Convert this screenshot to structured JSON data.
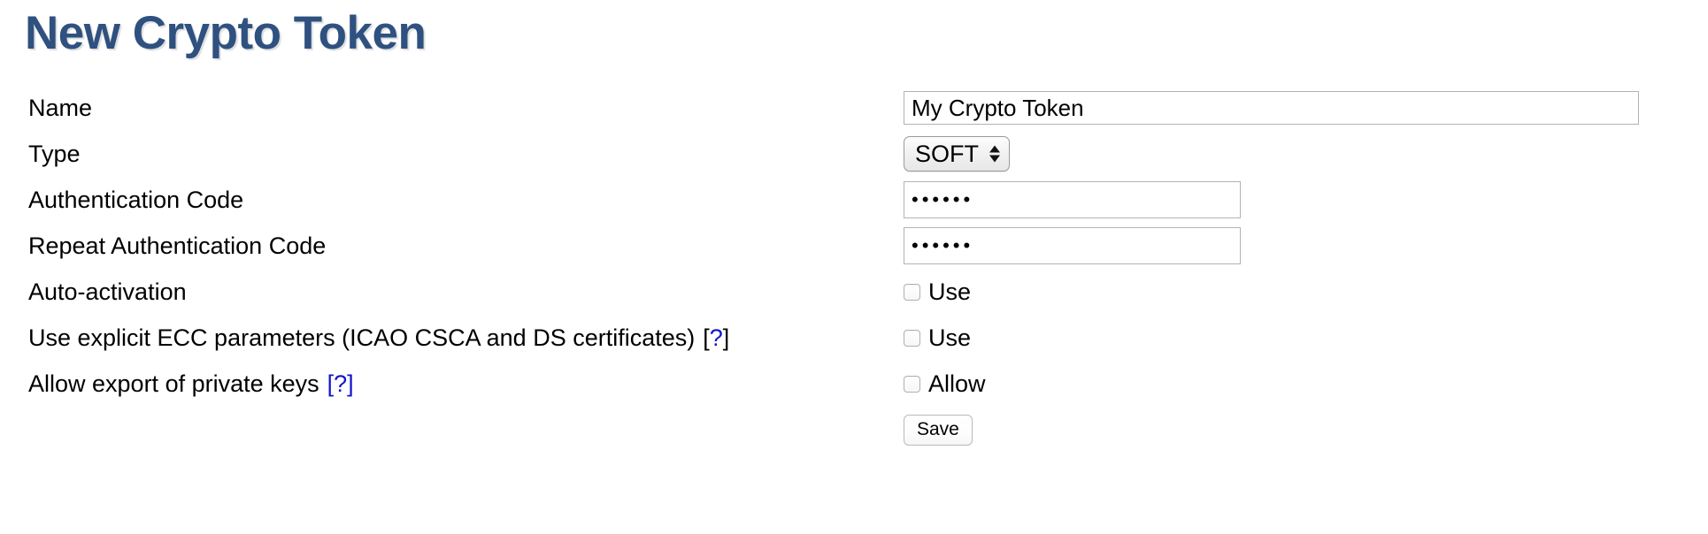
{
  "page": {
    "title": "New Crypto Token",
    "title_color": "#2f5180"
  },
  "form": {
    "rows": [
      {
        "label": "Name",
        "field_type": "text",
        "value": "My Crypto Token"
      },
      {
        "label": "Type",
        "field_type": "select",
        "value": "SOFT",
        "options": [
          "SOFT"
        ]
      },
      {
        "label": "Authentication Code",
        "field_type": "password",
        "value": "••••••",
        "masked_length": 6
      },
      {
        "label": "Repeat Authentication Code",
        "field_type": "password",
        "value": "••••••",
        "masked_length": 6
      },
      {
        "label": "Auto-activation",
        "field_type": "checkbox",
        "checkbox_label": "Use",
        "checked": false
      },
      {
        "label": "Use explicit ECC parameters (ICAO CSCA and DS certificates)",
        "help": "[?]",
        "help_open": "[",
        "help_mark": "?",
        "help_close": "]",
        "field_type": "checkbox",
        "checkbox_label": "Use",
        "checked": false
      },
      {
        "label": "Allow export of private keys",
        "help": "[?]",
        "help_open": "[",
        "help_mark": "?",
        "help_close": "]",
        "field_type": "checkbox",
        "checkbox_label": "Allow",
        "checked": false
      }
    ],
    "save_label": "Save"
  },
  "colors": {
    "title": "#2f5180",
    "link": "#1414cf",
    "input_border": "#b3b3b3",
    "background": "#ffffff",
    "text": "#000000"
  }
}
